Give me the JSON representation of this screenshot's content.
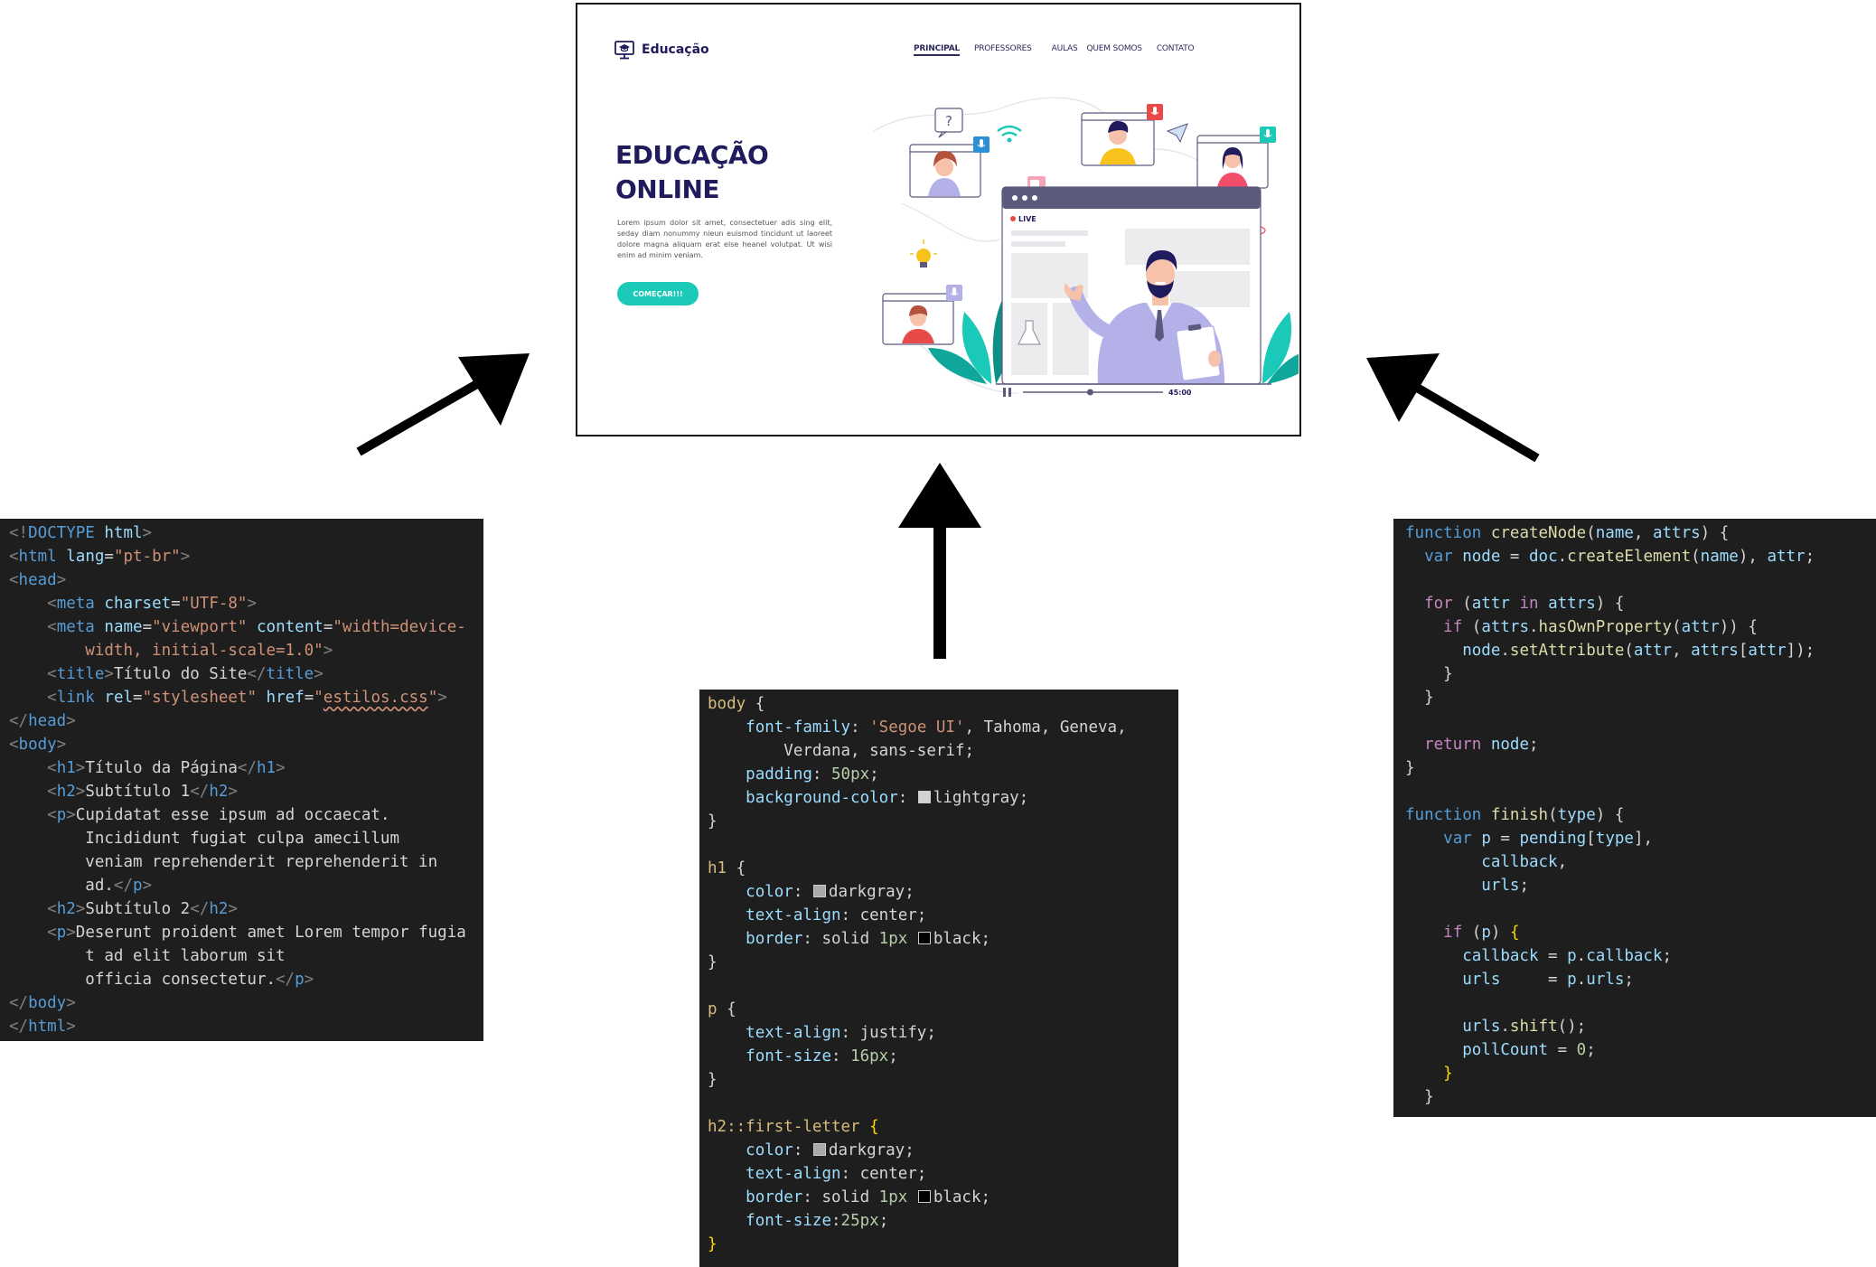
{
  "website": {
    "brand": "Educação",
    "nav": [
      "PRINCIPAL",
      "PROFESSORES",
      "AULAS",
      "QUEM SOMOS",
      "CONTATO"
    ],
    "hero_line1": "EDUCAÇÃO",
    "hero_line2": "ONLINE",
    "hero_text": "Lorem ipsum dolor sit amet, consectetuer adis sing elit, seday diam nonummy nieun euismod tincidunt ut laoreet dolore magna aliquam erat else heanel volutpat. Ut wisi enim ad minim veniam.",
    "button": "COMEÇAR!!!",
    "live_label": "LIVE",
    "video_time": "45:00",
    "video_progress": 0.48,
    "help_symbol": "?"
  },
  "colors": {
    "navy": "#1f1b5c",
    "teal": "#1ac9b8",
    "lavender": "#b4b0e8",
    "window_header": "#5b5a7d",
    "code_bg": "#1e1e1e",
    "keyword_blue": "#569cd6",
    "attr_cyan": "#9cdcfe",
    "string_orange": "#ce9178",
    "selector_gold": "#d7ba7d",
    "function_yellow": "#dcdcaa",
    "number_green": "#b5cea8",
    "control_purple": "#c586c0"
  },
  "code_html": [
    [
      [
        "<!",
        "t"
      ],
      [
        "DOCTYPE",
        "k"
      ],
      [
        " ",
        "p"
      ],
      [
        "html",
        "a"
      ],
      [
        ">",
        "t"
      ]
    ],
    [
      [
        "<",
        "t"
      ],
      [
        "html",
        "k"
      ],
      [
        " ",
        "p"
      ],
      [
        "lang",
        "a"
      ],
      [
        "=",
        "p"
      ],
      [
        "\"pt-br\"",
        "s"
      ],
      [
        ">",
        "t"
      ]
    ],
    [
      [
        "<",
        "t"
      ],
      [
        "head",
        "k"
      ],
      [
        ">",
        "t"
      ]
    ],
    [
      [
        "    ",
        "p"
      ],
      [
        "<",
        "t"
      ],
      [
        "meta",
        "k"
      ],
      [
        " ",
        "p"
      ],
      [
        "charset",
        "a"
      ],
      [
        "=",
        "p"
      ],
      [
        "\"UTF-8\"",
        "s"
      ],
      [
        ">",
        "t"
      ]
    ],
    [
      [
        "    ",
        "p"
      ],
      [
        "<",
        "t"
      ],
      [
        "meta",
        "k"
      ],
      [
        " ",
        "p"
      ],
      [
        "name",
        "a"
      ],
      [
        "=",
        "p"
      ],
      [
        "\"viewport\"",
        "s"
      ],
      [
        " ",
        "p"
      ],
      [
        "content",
        "a"
      ],
      [
        "=",
        "p"
      ],
      [
        "\"width=device-",
        "s"
      ]
    ],
    [
      [
        "        ",
        "p"
      ],
      [
        "width, initial-scale=1.0\"",
        "s"
      ],
      [
        ">",
        "t"
      ]
    ],
    [
      [
        "    ",
        "p"
      ],
      [
        "<",
        "t"
      ],
      [
        "title",
        "k"
      ],
      [
        ">",
        "t"
      ],
      [
        "Título do Site",
        "p"
      ],
      [
        "</",
        "t"
      ],
      [
        "title",
        "k"
      ],
      [
        ">",
        "t"
      ]
    ],
    [
      [
        "    ",
        "p"
      ],
      [
        "<",
        "t"
      ],
      [
        "link",
        "k"
      ],
      [
        " ",
        "p"
      ],
      [
        "rel",
        "a"
      ],
      [
        "=",
        "p"
      ],
      [
        "\"stylesheet\"",
        "s"
      ],
      [
        " ",
        "p"
      ],
      [
        "href",
        "a"
      ],
      [
        "=",
        "p"
      ],
      [
        "\"",
        "s"
      ],
      [
        "estilos.css",
        "u"
      ],
      [
        "\"",
        "s"
      ],
      [
        ">",
        "t"
      ]
    ],
    [
      [
        "</",
        "t"
      ],
      [
        "head",
        "k"
      ],
      [
        ">",
        "t"
      ]
    ],
    [
      [
        "<",
        "t"
      ],
      [
        "body",
        "k"
      ],
      [
        ">",
        "t"
      ]
    ],
    [
      [
        "    ",
        "p"
      ],
      [
        "<",
        "t"
      ],
      [
        "h1",
        "k"
      ],
      [
        ">",
        "t"
      ],
      [
        "Título da Página",
        "p"
      ],
      [
        "</",
        "t"
      ],
      [
        "h1",
        "k"
      ],
      [
        ">",
        "t"
      ]
    ],
    [
      [
        "    ",
        "p"
      ],
      [
        "<",
        "t"
      ],
      [
        "h2",
        "k"
      ],
      [
        ">",
        "t"
      ],
      [
        "Subtítulo 1",
        "p"
      ],
      [
        "</",
        "t"
      ],
      [
        "h2",
        "k"
      ],
      [
        ">",
        "t"
      ]
    ],
    [
      [
        "    ",
        "p"
      ],
      [
        "<",
        "t"
      ],
      [
        "p",
        "k"
      ],
      [
        ">",
        "t"
      ],
      [
        "Cupidatat esse ipsum ad occaecat.",
        "p"
      ]
    ],
    [
      [
        "        ",
        "p"
      ],
      [
        "Incididunt fugiat culpa amecillum",
        "p"
      ]
    ],
    [
      [
        "        ",
        "p"
      ],
      [
        "veniam reprehenderit reprehenderit in",
        "p"
      ]
    ],
    [
      [
        "        ",
        "p"
      ],
      [
        "ad.",
        "p"
      ],
      [
        "</",
        "t"
      ],
      [
        "p",
        "k"
      ],
      [
        ">",
        "t"
      ]
    ],
    [
      [
        "    ",
        "p"
      ],
      [
        "<",
        "t"
      ],
      [
        "h2",
        "k"
      ],
      [
        ">",
        "t"
      ],
      [
        "Subtítulo 2",
        "p"
      ],
      [
        "</",
        "t"
      ],
      [
        "h2",
        "k"
      ],
      [
        ">",
        "t"
      ]
    ],
    [
      [
        "    ",
        "p"
      ],
      [
        "<",
        "t"
      ],
      [
        "p",
        "k"
      ],
      [
        ">",
        "t"
      ],
      [
        "Deserunt proident amet Lorem tempor fugia",
        "p"
      ]
    ],
    [
      [
        "        ",
        "p"
      ],
      [
        "t ad elit laborum sit",
        "p"
      ]
    ],
    [
      [
        "        ",
        "p"
      ],
      [
        "officia consectetur.",
        "p"
      ],
      [
        "</",
        "t"
      ],
      [
        "p",
        "k"
      ],
      [
        ">",
        "t"
      ]
    ],
    [
      [
        "</",
        "t"
      ],
      [
        "body",
        "k"
      ],
      [
        ">",
        "t"
      ]
    ],
    [
      [
        "</",
        "t"
      ],
      [
        "html",
        "k"
      ],
      [
        ">",
        "t"
      ]
    ]
  ],
  "code_css": [
    [
      [
        "body",
        "sel"
      ],
      [
        " {",
        "p"
      ]
    ],
    [
      [
        "    ",
        "p"
      ],
      [
        "font-family",
        "a"
      ],
      [
        ": ",
        "p"
      ],
      [
        "'Segoe UI'",
        "s"
      ],
      [
        ", Tahoma, Geneva,",
        "p"
      ]
    ],
    [
      [
        "        ",
        "p"
      ],
      [
        "Verdana, sans-serif;",
        "p"
      ]
    ],
    [
      [
        "    ",
        "p"
      ],
      [
        "padding",
        "a"
      ],
      [
        ": ",
        "p"
      ],
      [
        "50px",
        "n"
      ],
      [
        ";",
        "p"
      ]
    ],
    [
      [
        "    ",
        "p"
      ],
      [
        "background-color",
        "a"
      ],
      [
        ": ",
        "p"
      ],
      [
        "#d3d3d3",
        "sw"
      ],
      [
        "lightgray;",
        "p"
      ]
    ],
    [
      [
        "}",
        "p"
      ]
    ],
    [
      [
        "",
        "p"
      ]
    ],
    [
      [
        "h1",
        "sel"
      ],
      [
        " {",
        "p"
      ]
    ],
    [
      [
        "    ",
        "p"
      ],
      [
        "color",
        "a"
      ],
      [
        ": ",
        "p"
      ],
      [
        "#a9a9a9",
        "sw"
      ],
      [
        "darkgray;",
        "p"
      ]
    ],
    [
      [
        "    ",
        "p"
      ],
      [
        "text-align",
        "a"
      ],
      [
        ": center;",
        "p"
      ]
    ],
    [
      [
        "    ",
        "p"
      ],
      [
        "border",
        "a"
      ],
      [
        ": solid ",
        "p"
      ],
      [
        "1px",
        "n"
      ],
      [
        " ",
        "p"
      ],
      [
        "#000000",
        "sw"
      ],
      [
        "black;",
        "p"
      ]
    ],
    [
      [
        "}",
        "p"
      ]
    ],
    [
      [
        "",
        "p"
      ]
    ],
    [
      [
        "p",
        "sel"
      ],
      [
        " {",
        "p"
      ]
    ],
    [
      [
        "    ",
        "p"
      ],
      [
        "text-align",
        "a"
      ],
      [
        ": justify;",
        "p"
      ]
    ],
    [
      [
        "    ",
        "p"
      ],
      [
        "font-size",
        "a"
      ],
      [
        ": ",
        "p"
      ],
      [
        "16px",
        "n"
      ],
      [
        ";",
        "p"
      ]
    ],
    [
      [
        "}",
        "p"
      ]
    ],
    [
      [
        "",
        "p"
      ]
    ],
    [
      [
        "h2::first-letter",
        "sel"
      ],
      [
        " ",
        "p"
      ],
      [
        "{",
        "br"
      ]
    ],
    [
      [
        "    ",
        "p"
      ],
      [
        "color",
        "a"
      ],
      [
        ": ",
        "p"
      ],
      [
        "#a9a9a9",
        "sw"
      ],
      [
        "darkgray;",
        "p"
      ]
    ],
    [
      [
        "    ",
        "p"
      ],
      [
        "text-align",
        "a"
      ],
      [
        ": center;",
        "p"
      ]
    ],
    [
      [
        "    ",
        "p"
      ],
      [
        "border",
        "a"
      ],
      [
        ": solid ",
        "p"
      ],
      [
        "1px",
        "n"
      ],
      [
        " ",
        "p"
      ],
      [
        "#000000",
        "sw"
      ],
      [
        "black;",
        "p"
      ]
    ],
    [
      [
        "    ",
        "p"
      ],
      [
        "font-size",
        "a"
      ],
      [
        ":",
        "p"
      ],
      [
        "25px",
        "n"
      ],
      [
        ";",
        "p"
      ]
    ],
    [
      [
        "}",
        "br"
      ]
    ]
  ],
  "code_js": [
    [
      [
        "function",
        "k"
      ],
      [
        " ",
        "p"
      ],
      [
        "createNode",
        "f"
      ],
      [
        "(",
        "p"
      ],
      [
        "name",
        "a"
      ],
      [
        ", ",
        "p"
      ],
      [
        "attrs",
        "a"
      ],
      [
        ") {",
        "p"
      ]
    ],
    [
      [
        "  ",
        "p"
      ],
      [
        "var",
        "k"
      ],
      [
        " ",
        "p"
      ],
      [
        "node",
        "a"
      ],
      [
        " = ",
        "p"
      ],
      [
        "doc",
        "a"
      ],
      [
        ".",
        "p"
      ],
      [
        "createElement",
        "f"
      ],
      [
        "(",
        "p"
      ],
      [
        "name",
        "a"
      ],
      [
        "), ",
        "p"
      ],
      [
        "attr",
        "a"
      ],
      [
        ";",
        "p"
      ]
    ],
    [
      [
        "",
        "p"
      ]
    ],
    [
      [
        "  ",
        "p"
      ],
      [
        "for",
        "k"
      ],
      [
        " (",
        "p"
      ],
      [
        "attr",
        "a"
      ],
      [
        " ",
        "p"
      ],
      [
        "in",
        "k"
      ],
      [
        " ",
        "p"
      ],
      [
        "attrs",
        "a"
      ],
      [
        ") {",
        "p"
      ]
    ],
    [
      [
        "    ",
        "p"
      ],
      [
        "if",
        "k"
      ],
      [
        " (",
        "p"
      ],
      [
        "attrs",
        "a"
      ],
      [
        ".",
        "p"
      ],
      [
        "hasOwnProperty",
        "f"
      ],
      [
        "(",
        "p"
      ],
      [
        "attr",
        "a"
      ],
      [
        ")) {",
        "p"
      ]
    ],
    [
      [
        "      ",
        "p"
      ],
      [
        "node",
        "a"
      ],
      [
        ".",
        "p"
      ],
      [
        "setAttribute",
        "f"
      ],
      [
        "(",
        "p"
      ],
      [
        "attr",
        "a"
      ],
      [
        ", ",
        "p"
      ],
      [
        "attrs",
        "a"
      ],
      [
        "[",
        "p"
      ],
      [
        "attr",
        "a"
      ],
      [
        "]);",
        "p"
      ]
    ],
    [
      [
        "    }",
        "p"
      ]
    ],
    [
      [
        "  }",
        "p"
      ]
    ],
    [
      [
        "",
        "p"
      ]
    ],
    [
      [
        "  ",
        "p"
      ],
      [
        "return",
        "k"
      ],
      [
        " ",
        "p"
      ],
      [
        "node",
        "a"
      ],
      [
        ";",
        "p"
      ]
    ],
    [
      [
        "}",
        "p"
      ]
    ],
    [
      [
        "",
        "p"
      ]
    ],
    [
      [
        "function",
        "k"
      ],
      [
        " ",
        "p"
      ],
      [
        "finish",
        "f"
      ],
      [
        "(",
        "p"
      ],
      [
        "type",
        "a"
      ],
      [
        ") {",
        "p"
      ]
    ],
    [
      [
        "    ",
        "p"
      ],
      [
        "var",
        "k"
      ],
      [
        " ",
        "p"
      ],
      [
        "p",
        "a"
      ],
      [
        " = ",
        "p"
      ],
      [
        "pending",
        "a"
      ],
      [
        "[",
        "p"
      ],
      [
        "type",
        "a"
      ],
      [
        "],",
        "p"
      ]
    ],
    [
      [
        "        ",
        "p"
      ],
      [
        "callback",
        "a"
      ],
      [
        ",",
        "p"
      ]
    ],
    [
      [
        "        ",
        "p"
      ],
      [
        "urls",
        "a"
      ],
      [
        ";",
        "p"
      ]
    ],
    [
      [
        "",
        "p"
      ]
    ],
    [
      [
        "    ",
        "p"
      ],
      [
        "if",
        "k"
      ],
      [
        " (",
        "p"
      ],
      [
        "p",
        "a"
      ],
      [
        ") ",
        "p"
      ],
      [
        "{",
        "br"
      ]
    ],
    [
      [
        "      ",
        "p"
      ],
      [
        "callback",
        "a"
      ],
      [
        " = ",
        "p"
      ],
      [
        "p",
        "a"
      ],
      [
        ".",
        "p"
      ],
      [
        "callback",
        "a"
      ],
      [
        ";",
        "p"
      ]
    ],
    [
      [
        "      ",
        "p"
      ],
      [
        "urls",
        "a"
      ],
      [
        "     = ",
        "p"
      ],
      [
        "p",
        "a"
      ],
      [
        ".",
        "p"
      ],
      [
        "urls",
        "a"
      ],
      [
        ";",
        "p"
      ]
    ],
    [
      [
        "",
        "p"
      ]
    ],
    [
      [
        "      ",
        "p"
      ],
      [
        "urls",
        "a"
      ],
      [
        ".",
        "p"
      ],
      [
        "shift",
        "f"
      ],
      [
        "();",
        "p"
      ]
    ],
    [
      [
        "      ",
        "p"
      ],
      [
        "pollCount",
        "a"
      ],
      [
        " = ",
        "p"
      ],
      [
        "0",
        "n"
      ],
      [
        ";",
        "p"
      ]
    ],
    [
      [
        "    ",
        "p"
      ],
      [
        "}",
        "br"
      ]
    ],
    [
      [
        "  }",
        "p"
      ]
    ]
  ]
}
